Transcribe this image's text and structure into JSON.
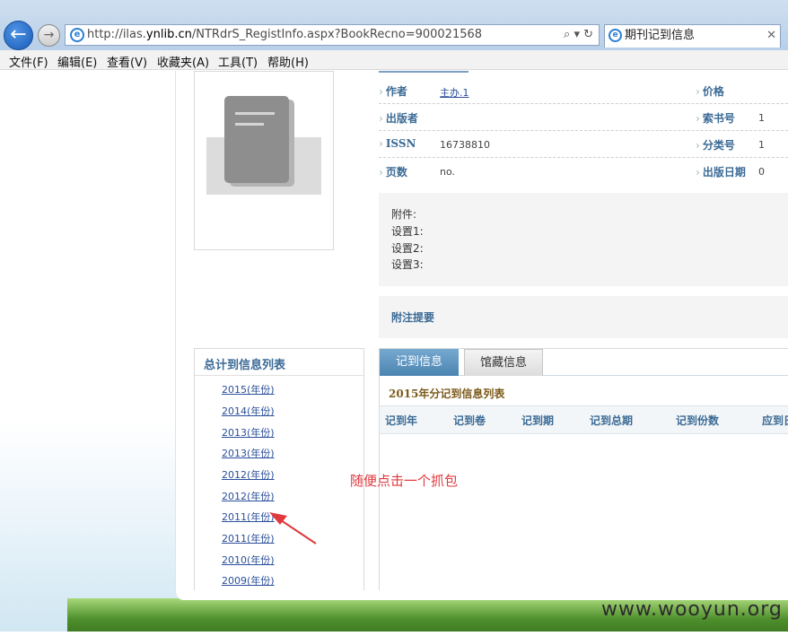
{
  "browser": {
    "url_prefix": "http://ilas.",
    "url_host": "ynlib.cn",
    "url_path": "/NTRdrS_RegistInfo.aspx?BookRecno=900021568",
    "url_tools": "⌕ ▾ ↻",
    "tab_title": "期刊记到信息",
    "tab_close": "✕",
    "back_icon": "←",
    "forward_icon": "→"
  },
  "menu": [
    "文件(F)",
    "编辑(E)",
    "查看(V)",
    "收藏夹(A)",
    "工具(T)",
    "帮助(H)"
  ],
  "info": [
    {
      "label": "作者",
      "value": "主办.1",
      "link": true,
      "label2": "价格",
      "value2": ""
    },
    {
      "label": "出版者",
      "value": "",
      "link": false,
      "label2": "索书号",
      "value2": "1"
    },
    {
      "label": "ISSN",
      "value": "16738810",
      "link": false,
      "label2": "分类号",
      "value2": "1"
    },
    {
      "label": "页数",
      "value": "no.",
      "link": false,
      "label2": "出版日期",
      "value2": "0"
    }
  ],
  "extra": [
    "附件:",
    "设置1:",
    "设置2:",
    "设置3:"
  ],
  "notes_label": "附注提要",
  "years_header": "总计到信息列表",
  "years": [
    "2015(年份)",
    "2014(年份)",
    "2013(年份)",
    "2013(年份)",
    "2012(年份)",
    "2012(年份)",
    "2011(年份)",
    "2011(年份)",
    "2010(年份)",
    "2009(年份)"
  ],
  "tabs": {
    "active": "记到信息",
    "inactive": "馆藏信息"
  },
  "table_title": "2015年分记到信息列表",
  "columns": [
    "记到年",
    "记到卷",
    "记到期",
    "记到总期",
    "记到份数",
    "应到日"
  ],
  "annotation": "随便点击一个抓包",
  "watermark": "www.wooyun.org",
  "colors": {
    "accent": "#4b84b2",
    "annotation": "#e0393e",
    "label": "#3b6a95"
  }
}
